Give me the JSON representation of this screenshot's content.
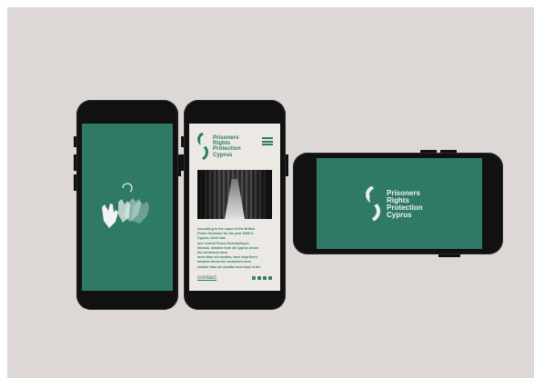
{
  "brand": {
    "line1": "Prisoners",
    "line2": "Rights",
    "line3": "Protection",
    "line4": "Cyprus"
  },
  "article": {
    "lines": [
      "According to the report of the British",
      "Police Governor for the year 1999 in",
      "Cyprus, there was",
      "one Central Prison functioning in",
      "Nicosia. Inmates from all Cyprus whom",
      "the sentences were",
      "more than six months, were kept there.",
      "Inmates whom the sentences were",
      "smaller than six months were kept in the"
    ]
  },
  "footer": {
    "contact": "contact",
    "social_icons": [
      "facebook-icon",
      "instagram-icon",
      "twitter-icon",
      "youtube-icon"
    ]
  },
  "colors": {
    "brand_green": "#2f7a66",
    "background": "#ddd8d5",
    "phone_body": "#111111",
    "page_light": "#ece8e3"
  }
}
